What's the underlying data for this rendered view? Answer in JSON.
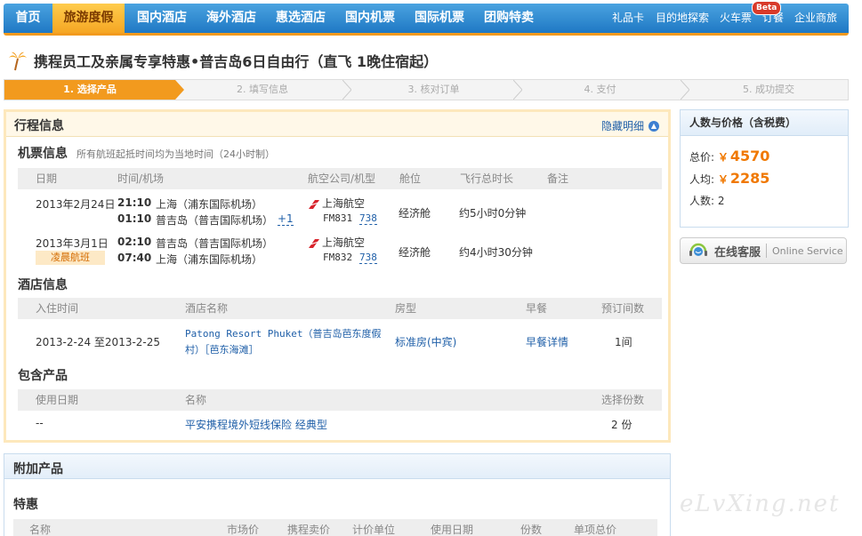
{
  "nav": {
    "items": [
      {
        "label": "首页",
        "active": false
      },
      {
        "label": "旅游度假",
        "active": true
      },
      {
        "label": "国内酒店",
        "active": false
      },
      {
        "label": "海外酒店",
        "active": false
      },
      {
        "label": "惠选酒店",
        "active": false
      },
      {
        "label": "国内机票",
        "active": false
      },
      {
        "label": "国际机票",
        "active": false
      },
      {
        "label": "团购特卖",
        "active": false
      }
    ],
    "right": [
      "礼品卡",
      "目的地探索",
      "火车票",
      "订餐",
      "企业商旅"
    ],
    "beta_badge": "Beta"
  },
  "page_title": "携程员工及亲属专享特惠•普吉岛6日自由行（直飞 1晚住宿起）",
  "steps": [
    "1. 选择产品",
    "2. 填写信息",
    "3. 核对订单",
    "4. 支付",
    "5. 成功提交"
  ],
  "itinerary": {
    "title": "行程信息",
    "hide_label": "隐藏明细",
    "flight_section": {
      "title": "机票信息",
      "note": "所有航班起抵时间均为当地时间（24小时制）",
      "headers": [
        "日期",
        "时间/机场",
        "航空公司/机型",
        "舱位",
        "飞行总时长",
        "备注"
      ],
      "rows": [
        {
          "date": "2013年2月24日",
          "dep_time": "21:10",
          "dep_airport": "上海（浦东国际机场）",
          "arr_time": "01:10",
          "arr_airport": "普吉岛（普吉国际机场）",
          "day_offset": "+1",
          "airline": "上海航空",
          "flight_no": "FM831",
          "aircraft": "738",
          "cabin": "经济舱",
          "duration": "约5小时0分钟",
          "tag": ""
        },
        {
          "date": "2013年3月1日",
          "dep_time": "02:10",
          "dep_airport": "普吉岛（普吉国际机场）",
          "arr_time": "07:40",
          "arr_airport": "上海（浦东国际机场）",
          "day_offset": "",
          "airline": "上海航空",
          "flight_no": "FM832",
          "aircraft": "738",
          "cabin": "经济舱",
          "duration": "约4小时30分钟",
          "tag": "凌晨航班"
        }
      ]
    },
    "hotel_section": {
      "title": "酒店信息",
      "headers": [
        "入住时间",
        "酒店名称",
        "房型",
        "早餐",
        "预订间数"
      ],
      "row": {
        "dates": "2013-2-24 至2013-2-25",
        "hotel_line1": "Patong Resort Phuket（普吉岛芭东度假",
        "hotel_line2": "村）［芭东海滩］",
        "room": "标准房(中宾)",
        "breakfast": "早餐详情",
        "rooms": "1间"
      }
    },
    "product_section": {
      "title": "包含产品",
      "headers": [
        "使用日期",
        "名称",
        "选择份数"
      ],
      "row": {
        "date": "--",
        "name": "平安携程境外短线保险 经典型",
        "qty": "2 份"
      }
    }
  },
  "addon": {
    "title": "附加产品",
    "sub_title": "特惠",
    "headers": [
      "名称",
      "市场价",
      "携程卖价",
      "计价单位",
      "使用日期",
      "份数",
      "单项总价"
    ]
  },
  "price": {
    "title": "人数与价格（含税费）",
    "total_label": "总价:",
    "total_value": "4570",
    "per_label": "人均:",
    "per_value": "2285",
    "people_label": "人数:",
    "people_value": "2",
    "currency": "￥"
  },
  "service": {
    "cn": "在线客服",
    "en": "Online Service"
  },
  "watermark": "eLvXing.net"
}
